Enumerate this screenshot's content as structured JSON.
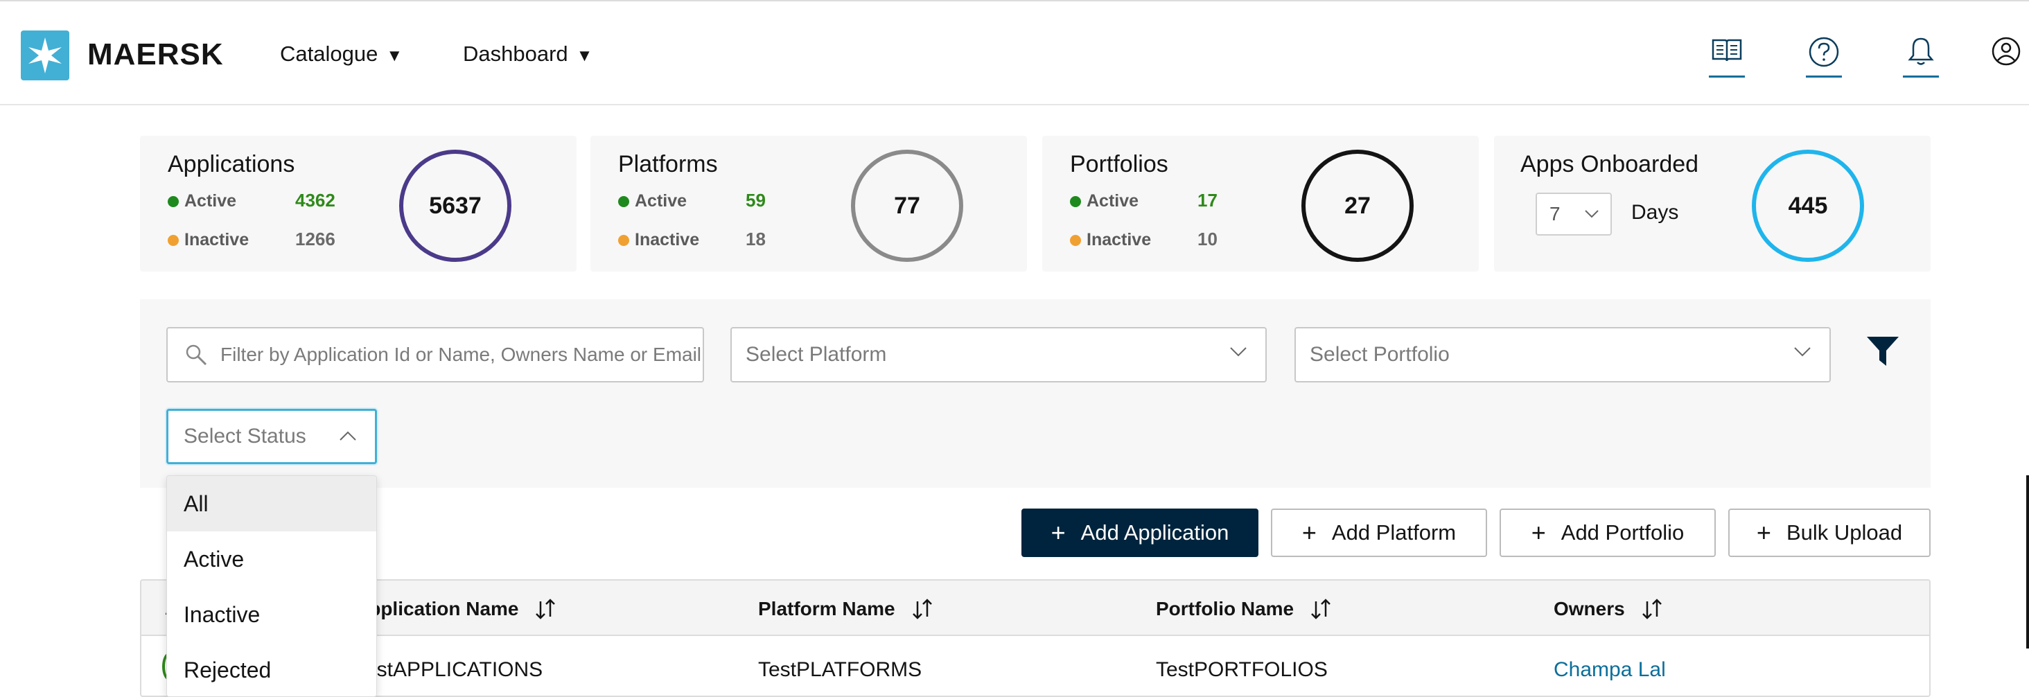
{
  "header": {
    "logo_text": "MAERSK",
    "nav": [
      {
        "label": "Catalogue",
        "caret": "▼"
      },
      {
        "label": "Dashboard",
        "caret": "▼"
      }
    ],
    "icons": [
      "book-icon",
      "help-icon",
      "bell-icon",
      "user-icon"
    ]
  },
  "cards": {
    "applications": {
      "title": "Applications",
      "active_label": "Active",
      "active": "4362",
      "inactive_label": "Inactive",
      "inactive": "1266",
      "total": "5637",
      "ring_color": "#4b3a8a"
    },
    "platforms": {
      "title": "Platforms",
      "active_label": "Active",
      "active": "59",
      "inactive_label": "Inactive",
      "inactive": "18",
      "total": "77",
      "ring_color": "#8a8a8a"
    },
    "portfolios": {
      "title": "Portfolios",
      "active_label": "Active",
      "active": "17",
      "inactive_label": "Inactive",
      "inactive": "10",
      "total": "27",
      "ring_color": "#141414"
    },
    "onboarded": {
      "title": "Apps Onboarded",
      "days_value": "7",
      "days_label": "Days",
      "total": "445",
      "ring_color": "#1fb5ec"
    }
  },
  "filters": {
    "search_placeholder": "Filter by Application Id or Name, Owners Name or Email",
    "platform_placeholder": "Select Platform",
    "portfolio_placeholder": "Select Portfolio",
    "status_placeholder": "Select Status"
  },
  "status_menu": [
    "All",
    "Active",
    "Inactive",
    "Rejected"
  ],
  "actions": {
    "add_application": "Add Application",
    "add_platform": "Add Platform",
    "add_portfolio": "Add Portfolio",
    "bulk_upload": "Bulk Upload"
  },
  "table": {
    "columns": [
      "Application Name",
      "Platform Name",
      "Portfolio Name",
      "Owners"
    ],
    "first_col_partial": "A",
    "rows": [
      {
        "application": "TestAPPLICATIONS",
        "platform": "TestPLATFORMS",
        "portfolio": "TestPORTFOLIOS",
        "owner": "Champa Lal"
      }
    ]
  },
  "colors": {
    "brand": "#42b0d5",
    "primary_button": "#00243d",
    "active_green": "#2e8a1a",
    "inactive_orange": "#f0a030",
    "link": "#0b6e9b"
  }
}
